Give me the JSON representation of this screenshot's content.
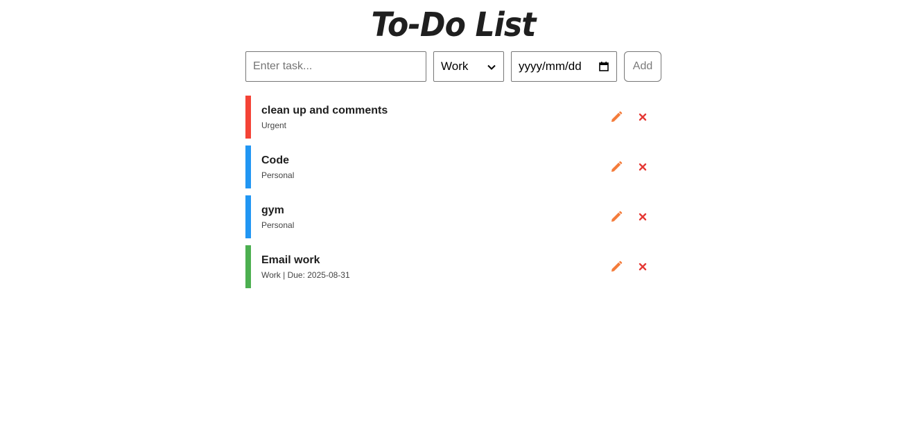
{
  "header": {
    "title": "To-Do List"
  },
  "form": {
    "task_placeholder": "Enter task...",
    "category_selected": "Work",
    "date_placeholder": "yyyy/mm/dd",
    "add_label": "Add"
  },
  "icons": {
    "edit": "pencil-icon",
    "delete": "close-icon",
    "select": "chevron-down-icon",
    "date": "calendar-icon"
  },
  "colors": {
    "urgent": "#f44336",
    "personal": "#2196f3",
    "work": "#4caf50",
    "edit_icon": "#f47b3a",
    "delete_icon": "#e53935"
  },
  "tasks": [
    {
      "title": "clean up and comments",
      "meta": "Urgent",
      "color": "#f44336"
    },
    {
      "title": "Code",
      "meta": "Personal",
      "color": "#2196f3"
    },
    {
      "title": "gym",
      "meta": "Personal",
      "color": "#2196f3"
    },
    {
      "title": "Email work",
      "meta": "Work | Due: 2025-08-31",
      "color": "#4caf50"
    }
  ]
}
